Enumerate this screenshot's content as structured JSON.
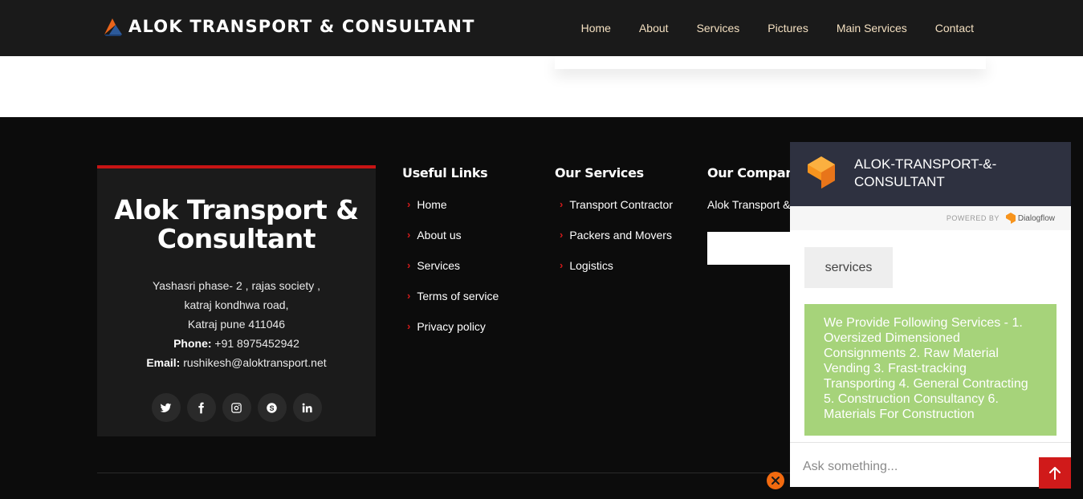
{
  "header": {
    "brand": "ALOK TRANSPORT & CONSULTANT",
    "nav": [
      "Home",
      "About",
      "Services",
      "Pictures",
      "Main Services",
      "Contact"
    ]
  },
  "footer": {
    "company": {
      "name": "Alok Transport & Consultant",
      "address": [
        "Yashasri phase- 2 , rajas society ,",
        "katraj kondhwa road,",
        "Katraj pune 411046"
      ],
      "phone_label": "Phone:",
      "phone": "+91 8975452942",
      "email_label": "Email:",
      "email": "rushikesh@aloktransport.net",
      "socials": [
        "twitter-icon",
        "facebook-icon",
        "instagram-icon",
        "skype-icon",
        "linkedin-icon"
      ]
    },
    "useful_links": {
      "title": "Useful Links",
      "items": [
        "Home",
        "About us",
        "Services",
        "Terms of service",
        "Privacy policy"
      ]
    },
    "our_services": {
      "title": "Our Services",
      "items": [
        "Transport Contractor",
        "Packers and Movers",
        "Logistics"
      ]
    },
    "our_company": {
      "title": "Our Company",
      "desc": "Alok Transport &"
    }
  },
  "chat": {
    "title_line1": "ALOK-TRANSPORT-&-",
    "title_line2": "CONSULTANT",
    "powered_by": "POWERED BY",
    "provider": "Dialogflow",
    "user_message": "services",
    "bot_message": "We Provide Following Services - 1. Oversized Dimensioned Consignments 2. Raw Material Vending 3. Frast-tracking Transporting 4. General Contracting 5. Construction Consultancy 6. Materials For Construction",
    "input_placeholder": "Ask something..."
  },
  "colors": {
    "header_bg": "#1a1a1a",
    "nav_text": "#f3dfc0",
    "accent_red": "#c81414",
    "chat_header": "#2e3140",
    "bot_bubble": "#a6d37a",
    "close_orange": "#f26a0f"
  }
}
